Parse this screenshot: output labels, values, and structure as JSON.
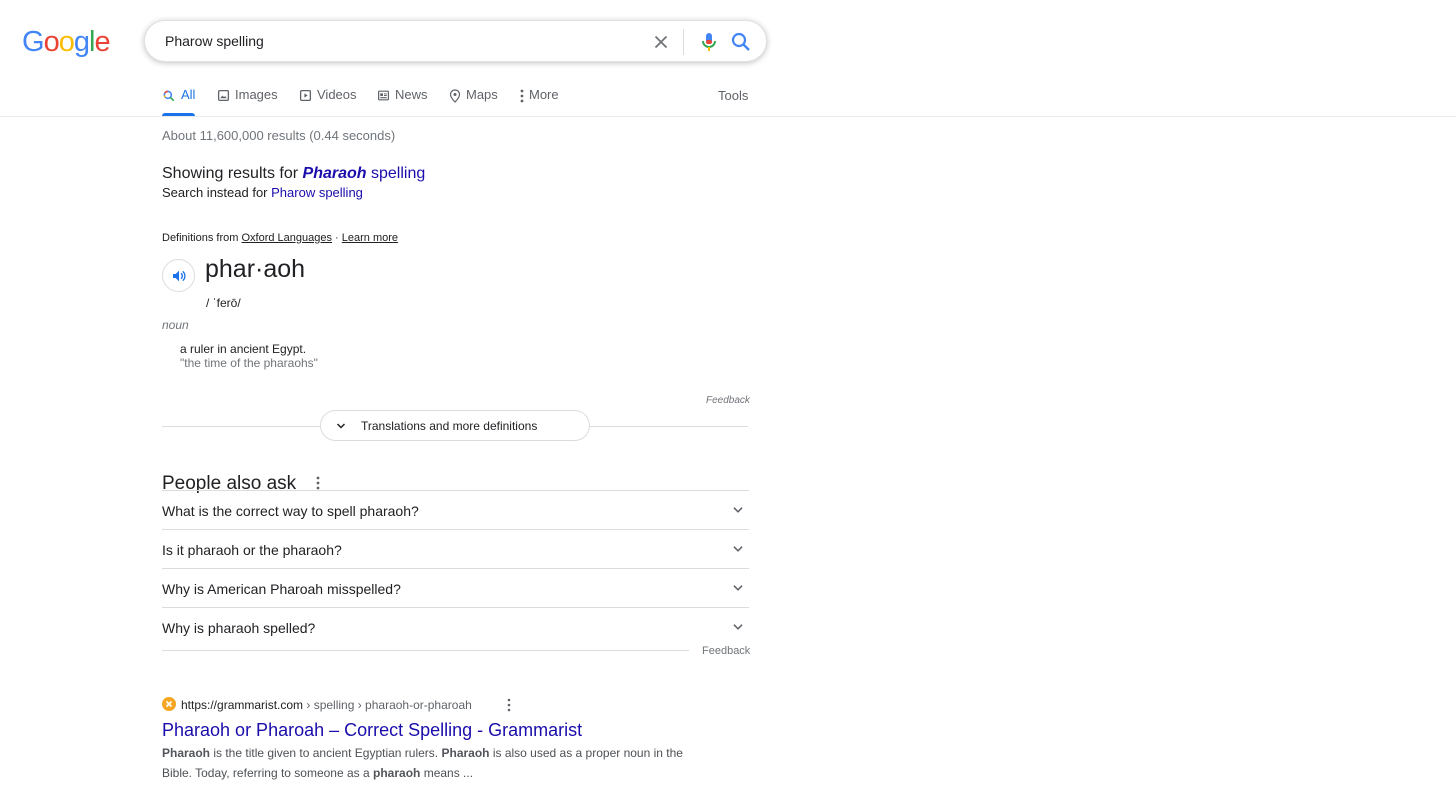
{
  "logo": {
    "letters": [
      {
        "char": "G",
        "color": "#4285F4"
      },
      {
        "char": "o",
        "color": "#EA4335"
      },
      {
        "char": "o",
        "color": "#FBBC05"
      },
      {
        "char": "g",
        "color": "#4285F4"
      },
      {
        "char": "l",
        "color": "#34A853"
      },
      {
        "char": "e",
        "color": "#EA4335"
      }
    ]
  },
  "search": {
    "query": "Pharow spelling",
    "clear_icon": "close-icon",
    "mic_icon": "microphone-icon",
    "search_icon": "search-icon"
  },
  "tabs": [
    {
      "label": "All",
      "icon": "search-icon",
      "active": true
    },
    {
      "label": "Images",
      "icon": "image-icon"
    },
    {
      "label": "Videos",
      "icon": "video-icon"
    },
    {
      "label": "News",
      "icon": "news-icon"
    },
    {
      "label": "Maps",
      "icon": "map-pin-icon"
    },
    {
      "label": "More",
      "icon": "more-vert-icon"
    }
  ],
  "tools_label": "Tools",
  "stats": "About 11,600,000 results (0.44 seconds)",
  "spelling": {
    "showing_prefix": "Showing results for ",
    "corrected_word": "Pharaoh",
    "corrected_rest": " spelling",
    "instead_prefix": "Search instead for ",
    "instead_link": "Pharow spelling"
  },
  "dictionary": {
    "source_prefix": "Definitions from ",
    "source_link": "Oxford Languages",
    "separator": " · ",
    "learn_more": "Learn more",
    "headword": "phar·aoh",
    "phonetic": "/ ˈferō/",
    "part_of_speech": "noun",
    "definition": "a ruler in ancient Egypt.",
    "example": "\"the time of the pharaohs\"",
    "feedback": "Feedback",
    "more_button": "Translations and more definitions"
  },
  "people_also_ask": {
    "title": "People also ask",
    "questions": [
      "What is the correct way to spell pharaoh?",
      "Is it pharaoh or the pharaoh?",
      "Why is American Pharoah misspelled?",
      "Why is pharaoh spelled?"
    ],
    "feedback": "Feedback"
  },
  "result": {
    "domain": "https://grammarist.com",
    "path": " › spelling › pharaoh-or-pharoah",
    "title": "Pharaoh or Pharoah – Correct Spelling - Grammarist",
    "snippet": [
      {
        "text": "Pharaoh",
        "bold": true
      },
      {
        "text": " is the title given to ancient Egyptian rulers. ",
        "bold": false
      },
      {
        "text": "Pharaoh",
        "bold": true
      },
      {
        "text": " is also used as a proper noun in the Bible. Today, referring to someone as a ",
        "bold": false
      },
      {
        "text": "pharaoh",
        "bold": true
      },
      {
        "text": " means ...",
        "bold": false
      }
    ]
  },
  "colors": {
    "link": "#1a0dab",
    "accent": "#1a73e8",
    "muted": "#70757a"
  }
}
